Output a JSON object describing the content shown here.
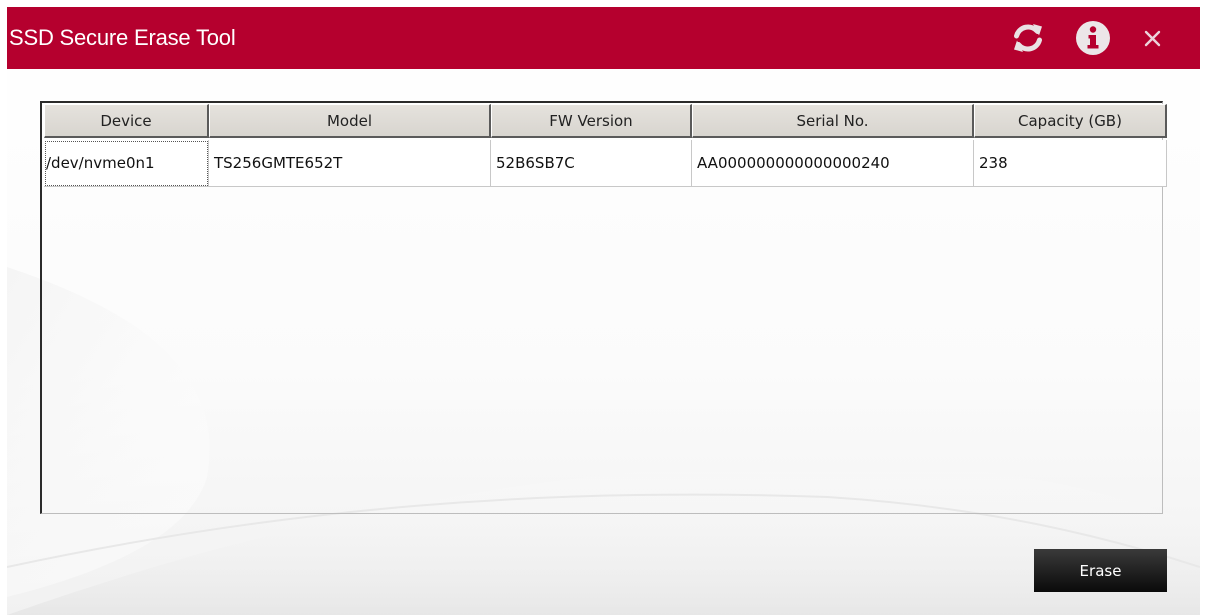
{
  "window": {
    "title": "SSD Secure Erase Tool",
    "accent_color": "#b5002e",
    "icons": {
      "refresh": "refresh-icon",
      "info": "info-icon",
      "close": "close-icon"
    }
  },
  "table": {
    "headers": [
      "Device",
      "Model",
      "FW Version",
      "Serial No.",
      "Capacity (GB)"
    ],
    "rows": [
      {
        "device": "/dev/nvme0n1",
        "model": "TS256GMTE652T",
        "fw_version": "52B6SB7C",
        "serial_no": "AA000000000000000240",
        "capacity_gb": "238"
      }
    ]
  },
  "actions": {
    "erase_label": "Erase"
  }
}
